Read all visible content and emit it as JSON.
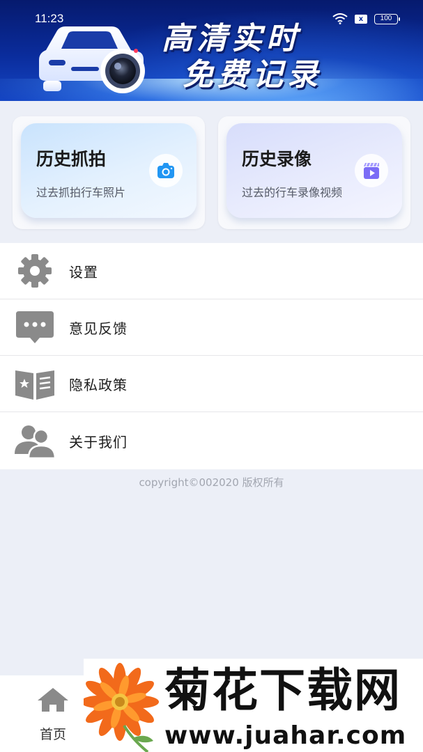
{
  "status_bar": {
    "time": "11:23",
    "sim_label": "x",
    "battery": "100"
  },
  "banner": {
    "line1": "高清实时",
    "line2": "免费记录"
  },
  "cards": [
    {
      "title": "历史抓拍",
      "subtitle": "过去抓拍行车照片",
      "icon": "camera-icon"
    },
    {
      "title": "历史录像",
      "subtitle": "过去的行车录像视频",
      "icon": "video-icon"
    }
  ],
  "menu": [
    {
      "label": "设置",
      "icon": "gear-icon"
    },
    {
      "label": "意见反馈",
      "icon": "chat-bubble-icon"
    },
    {
      "label": "隐私政策",
      "icon": "open-book-icon"
    },
    {
      "label": "关于我们",
      "icon": "users-icon"
    }
  ],
  "copyright": "copyright©002020 版权所有",
  "bottom_nav": {
    "home_label": "首页",
    "home_icon": "home-icon"
  },
  "watermark": {
    "name": "菊花下载网",
    "url": "www.juahar.com"
  },
  "colors": {
    "banner_dark": "#061a6e",
    "banner_light": "#1546c4",
    "page_bg": "#eceff7",
    "icon_gray": "#8a8a8a",
    "camera_blue": "#2196f3",
    "video_purple": "#7b6cf6"
  }
}
